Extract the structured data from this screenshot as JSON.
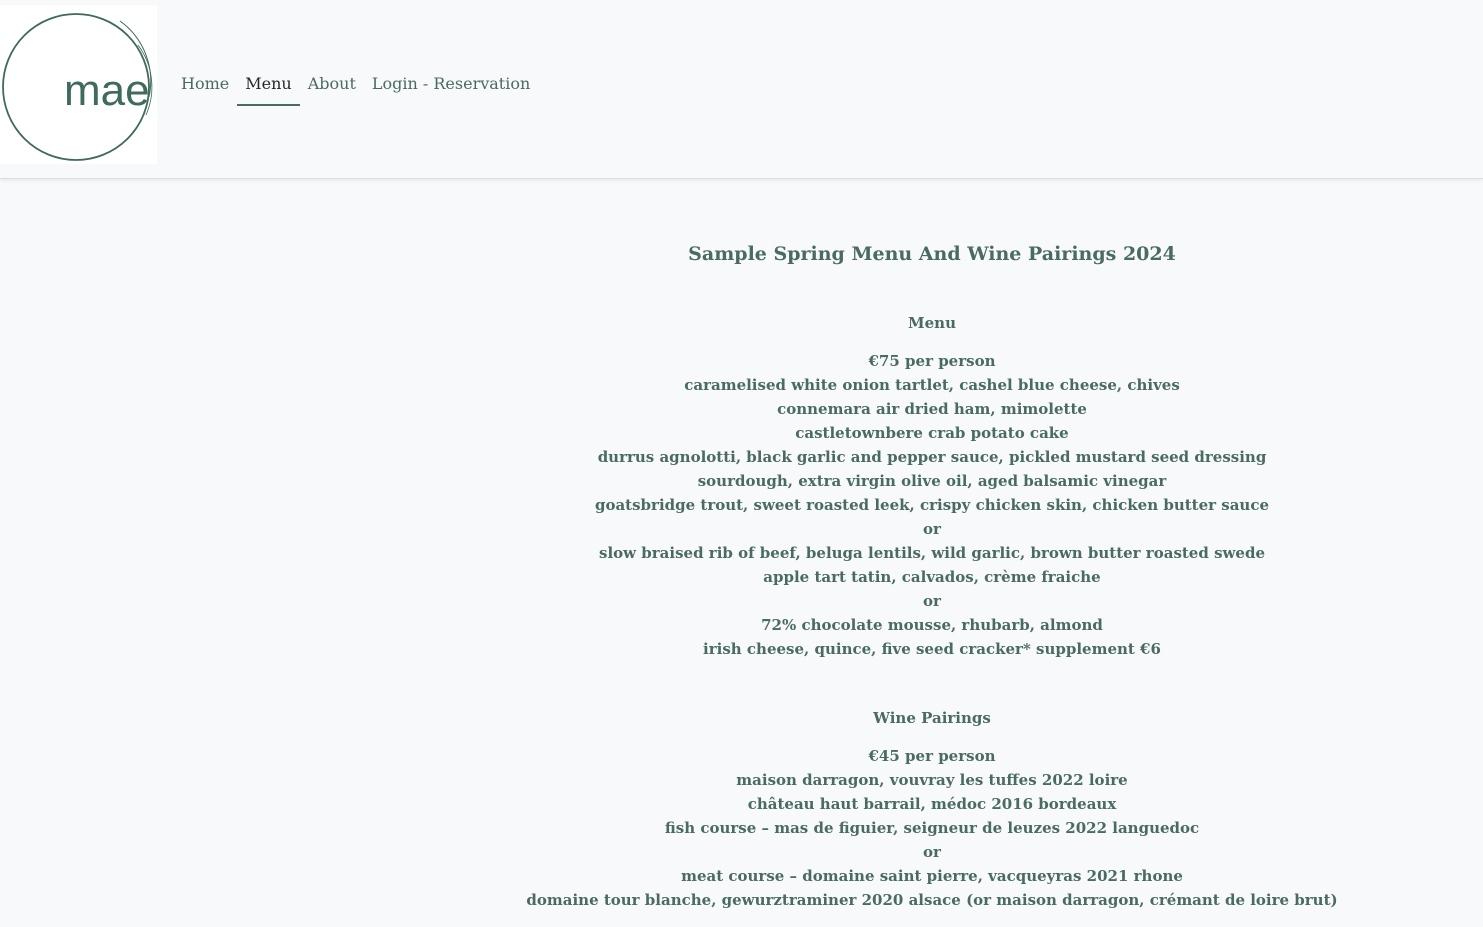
{
  "logo": {
    "text": "mae",
    "color": "#3f6a5d"
  },
  "nav": {
    "items": [
      {
        "label": "Home",
        "active": false
      },
      {
        "label": "Menu",
        "active": true
      },
      {
        "label": "About",
        "active": false
      },
      {
        "label": "Login - Reservation",
        "active": false
      }
    ]
  },
  "page": {
    "title": "Sample Spring Menu And Wine Pairings 2024"
  },
  "menu": {
    "heading": "Menu",
    "lines": [
      "€75 per person",
      "caramelised white onion tartlet, cashel blue cheese, chives",
      "connemara air dried ham, mimolette",
      "castletownbere crab potato cake",
      "durrus agnolotti, black garlic and pepper sauce, pickled mustard seed dressing",
      "sourdough, extra virgin olive oil, aged balsamic vinegar",
      "goatsbridge trout, sweet roasted leek, crispy chicken skin, chicken butter sauce",
      "or",
      "slow braised rib of beef, beluga lentils, wild garlic, brown butter roasted swede",
      "apple tart tatin, calvados, crème fraiche",
      "or",
      "72% chocolate mousse, rhubarb, almond",
      "irish cheese, quince, five seed cracker* supplement €6"
    ]
  },
  "wine": {
    "heading": "Wine Pairings",
    "lines": [
      "€45 per person",
      "maison darragon, vouvray les tuffes 2022 loire",
      "château haut barrail, médoc 2016 bordeaux",
      "fish course – mas de figuier, seigneur de leuzes 2022 languedoc",
      "or",
      "meat course – domaine saint pierre, vacqueyras 2021 rhone",
      "domaine tour blanche, gewurztraminer 2020 alsace (or maison darragon, crémant de loire brut)"
    ]
  },
  "colors": {
    "text": "#4a6b61",
    "active_nav": "#1f2a26",
    "background": "#f8f9fa",
    "logo_white": "#ffffff"
  }
}
